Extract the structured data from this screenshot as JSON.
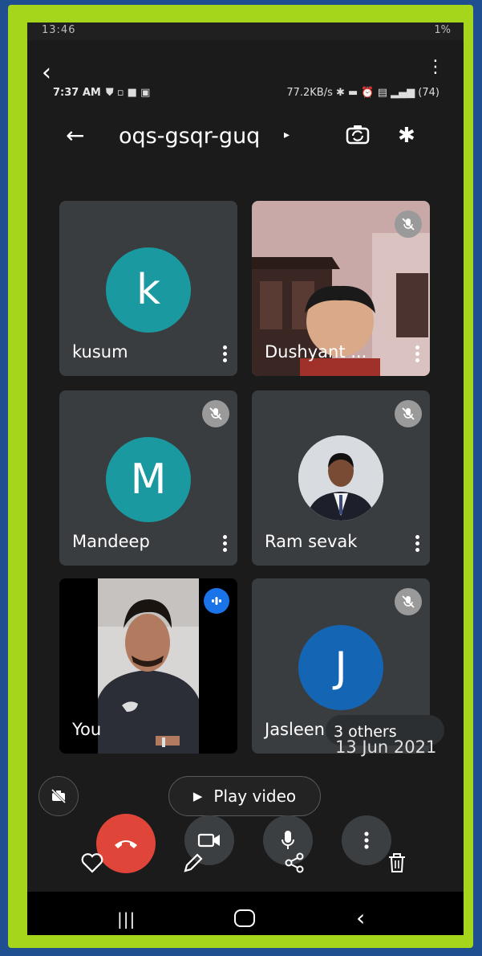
{
  "status_top": {
    "time": "13:46",
    "right": "1%"
  },
  "status_inner": {
    "time": "7:37 AM",
    "speed": "77.2KB/s",
    "battery": "74"
  },
  "meeting": {
    "code": "oqs-gsqr-guq"
  },
  "participants": [
    {
      "name": "kusum",
      "initial": "k",
      "color": "#1a9aa0",
      "muted": false
    },
    {
      "name": "Dushyant ...",
      "initial": "",
      "muted": true
    },
    {
      "name": "Mandeep",
      "initial": "M",
      "color": "#1a9aa0",
      "muted": true
    },
    {
      "name": "Ram sevak",
      "initial": "",
      "muted": true
    },
    {
      "name": "You",
      "initial": "",
      "muted": false,
      "speaking": true
    },
    {
      "name": "Jasleen",
      "initial": "J",
      "color": "#1565b5",
      "muted": true
    }
  ],
  "others_label": "3 others",
  "date_stamp": "13 Jun 2021",
  "play_video_label": "Play video",
  "icons": {
    "back": "back-arrow-icon",
    "switch_camera": "switch-camera-icon",
    "bluetooth": "bluetooth-icon",
    "mic_off": "mic-off-icon",
    "end_call": "end-call-icon",
    "video": "video-camera-icon",
    "mic": "microphone-icon",
    "more": "more-vert-icon",
    "heart": "heart-icon",
    "edit": "pencil-icon",
    "share": "share-icon",
    "delete": "trash-icon"
  }
}
